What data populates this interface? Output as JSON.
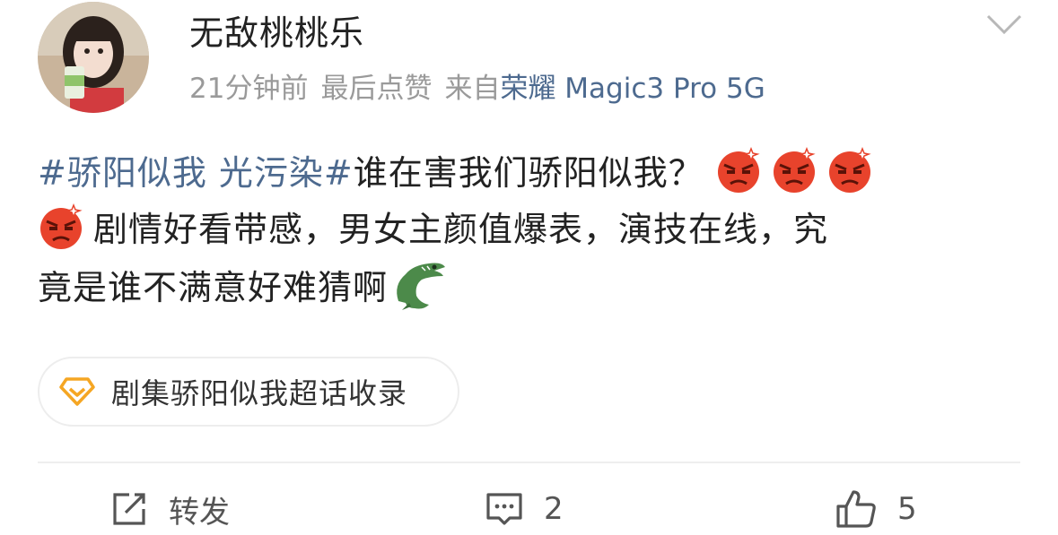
{
  "post": {
    "username": "无敌桃桃乐",
    "time": "21分钟前",
    "last_action": "最后点赞",
    "source_prefix": "来自",
    "source_device": "荣耀 Magic3 Pro 5G",
    "content": {
      "topic": "#骄阳似我 光污染#",
      "line1_text": "谁在害我们骄阳似我？",
      "line2_text": "剧情好看带感，男女主颜值爆表，演技在线，究",
      "line3_text": "竟是谁不满意好难猜啊",
      "emojis": [
        "angry-emoji",
        "angry-emoji",
        "angry-emoji",
        "angry-emoji",
        "crocodile-emoji"
      ]
    },
    "chip": {
      "label": "剧集骄阳似我超话收录",
      "icon": "diamond-icon"
    },
    "actions": {
      "repost_label": "转发",
      "comment_count": "2",
      "like_count": "5"
    }
  },
  "colors": {
    "topic": "#4d6a8f",
    "text": "#222222",
    "meta": "#9a9a9a",
    "chip_icon": "#f5a623",
    "emoji_red": "#e8432c"
  }
}
